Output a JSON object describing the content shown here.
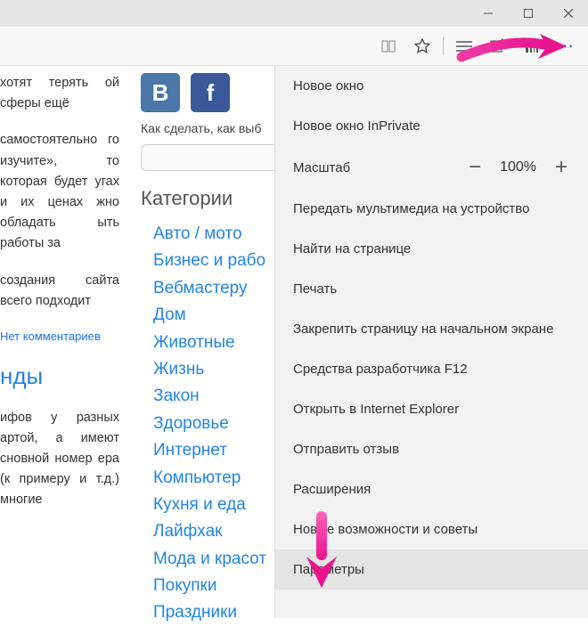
{
  "window": {
    "minimize": "Minimize",
    "maximize": "Maximize",
    "close": "Close"
  },
  "toolbar": {
    "more": "⋯"
  },
  "left": {
    "p1": "хотят терять ой сферы ещё",
    "p2": "самостоятельно го изучите», то которая будет угах и их ценах жно обладать ыть работы за",
    "p3": "создания сайта всего подходит",
    "nocom": "Нет комментариев",
    "hdr": "нды",
    "p4": "ифов у разных артой, а имеют сновной номер ера (к примеру и т.д.) многие"
  },
  "mid": {
    "tagline": "Как сделать, как выб",
    "cat_h": "Категории",
    "cats": [
      "Авто / мото",
      "Бизнес и рабо",
      "Вебмастеру",
      "Дом",
      "Животные",
      "Жизнь",
      "Закон",
      "Здоровье",
      "Интернет",
      "Компьютер",
      "Кухня и еда",
      "Лайфхак",
      "Мода и красот",
      "Покупки",
      "Праздники"
    ]
  },
  "menu": {
    "items1": [
      "Новое окно",
      "Новое окно InPrivate"
    ],
    "zoom_label": "Масштаб",
    "zoom_val": "100%",
    "items2": [
      "Передать мультимедиа на устройство",
      "Найти на странице",
      "Печать",
      "Закрепить страницу на начальном экране",
      "Средства разработчика F12",
      "Открыть в Internet Explorer",
      "Отправить отзыв",
      "Расширения",
      "Новые возможности и советы"
    ],
    "settings": "Параметры"
  },
  "arrows": {
    "color": "#f23ba7"
  }
}
